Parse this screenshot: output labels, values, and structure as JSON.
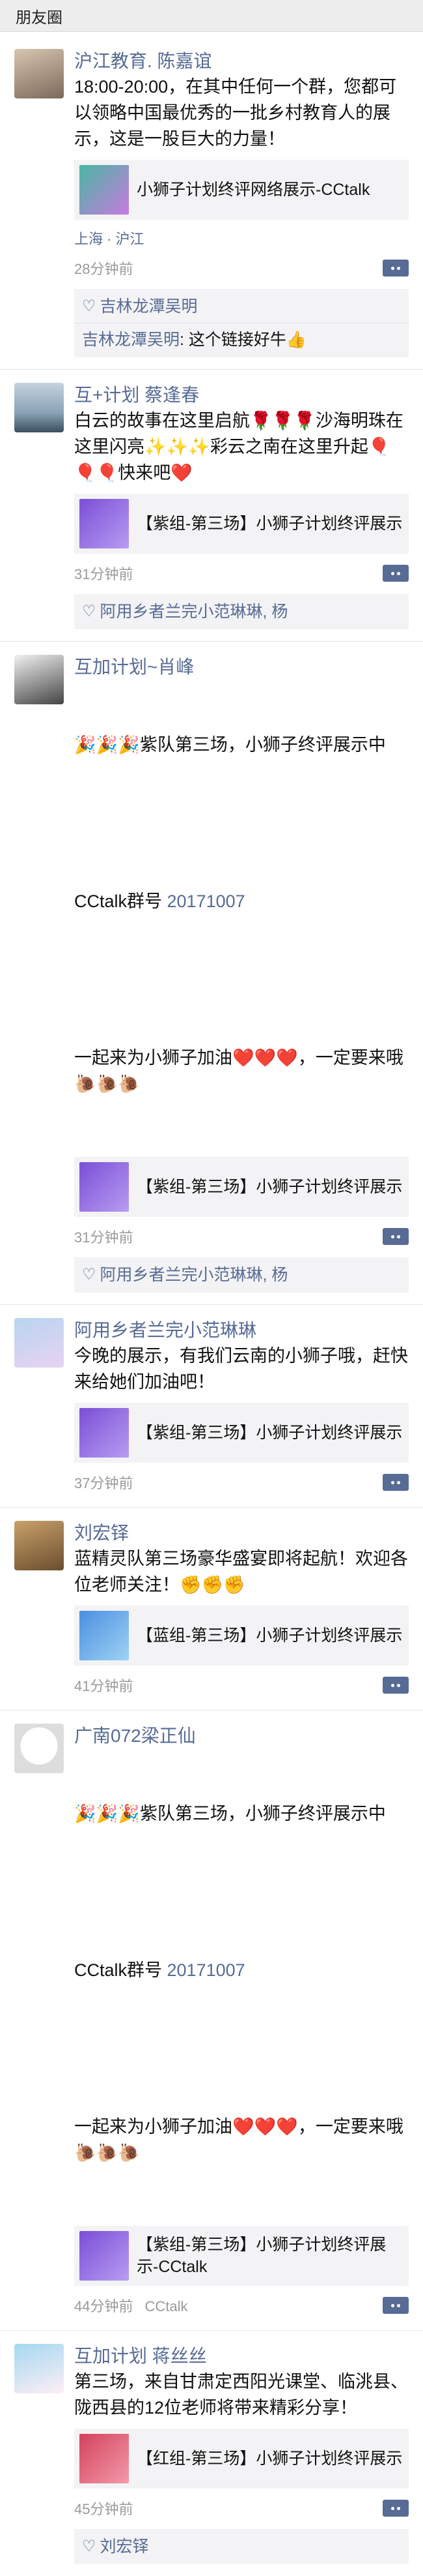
{
  "header": {
    "title": "朋友圈"
  },
  "posts": [
    {
      "name": "沪江教育. 陈嘉谊",
      "text": "18:00-20:00，在其中任何一个群，您都可以领略中国最优秀的一批乡村教育人的展示，这是一股巨大的力量！",
      "link": {
        "title": "小狮子计划终评网络展示-CCtalk"
      },
      "location": "上海 · 沪江",
      "time": "28分钟前",
      "likes": "吉林龙潭吴明",
      "comment": {
        "author": "吉林龙潭吴明",
        "text": ": 这个链接好牛👍"
      }
    },
    {
      "name": "互+计划 蔡逢春",
      "text": "白云的故事在这里启航🌹🌹🌹沙海明珠在这里闪亮✨✨✨彩云之南在这里升起🎈🎈🎈快来吧❤️",
      "link": {
        "title": "【紫组-第三场】小狮子计划终评展示"
      },
      "time": "31分钟前",
      "likes": "阿用乡者兰完小范琳琳, 杨"
    },
    {
      "name": "互加计划~肖峰",
      "line1": "🎉🎉🎉紫队第三场，小狮子终评展示中",
      "line2a": "CCtalk群号 ",
      "line2b": "20171007",
      "line3": "一起来为小狮子加油❤️❤️❤️，一定要来哦🐌🐌🐌",
      "link": {
        "title": "【紫组-第三场】小狮子计划终评展示"
      },
      "time": "31分钟前",
      "likes": "阿用乡者兰完小范琳琳, 杨"
    },
    {
      "name": "阿用乡者兰完小范琳琳",
      "text": "今晚的展示，有我们云南的小狮子哦，赶快来给她们加油吧！",
      "link": {
        "title": "【紫组-第三场】小狮子计划终评展示"
      },
      "time": "37分钟前"
    },
    {
      "name": "刘宏铎",
      "text": "蓝精灵队第三场豪华盛宴即将起航！欢迎各位老师关注！✊✊✊",
      "link": {
        "title": "【蓝组-第三场】小狮子计划终评展示"
      },
      "time": "41分钟前"
    },
    {
      "name": "广南072梁正仙",
      "line1": "🎉🎉🎉紫队第三场，小狮子终评展示中",
      "line2a": "CCtalk群号 ",
      "line2b": "20171007",
      "line3": "一起来为小狮子加油❤️❤️❤️，一定要来哦🐌🐌🐌",
      "link": {
        "title": "【紫组-第三场】小狮子计划终评展示-CCtalk"
      },
      "time": "44分钟前",
      "source": "CCtalk"
    },
    {
      "name": "互加计划 蒋丝丝",
      "text": "第三场，来自甘肃定西阳光课堂、临洮县、陇西县的12位老师将带来精彩分享！",
      "link": {
        "title": "【红组-第三场】小狮子计划终评展示"
      },
      "time": "45分钟前",
      "likes": "刘宏铎"
    }
  ],
  "colors": {
    "link": "#576b95",
    "meta": "#9a9a9a",
    "card": "#f3f3f5"
  }
}
